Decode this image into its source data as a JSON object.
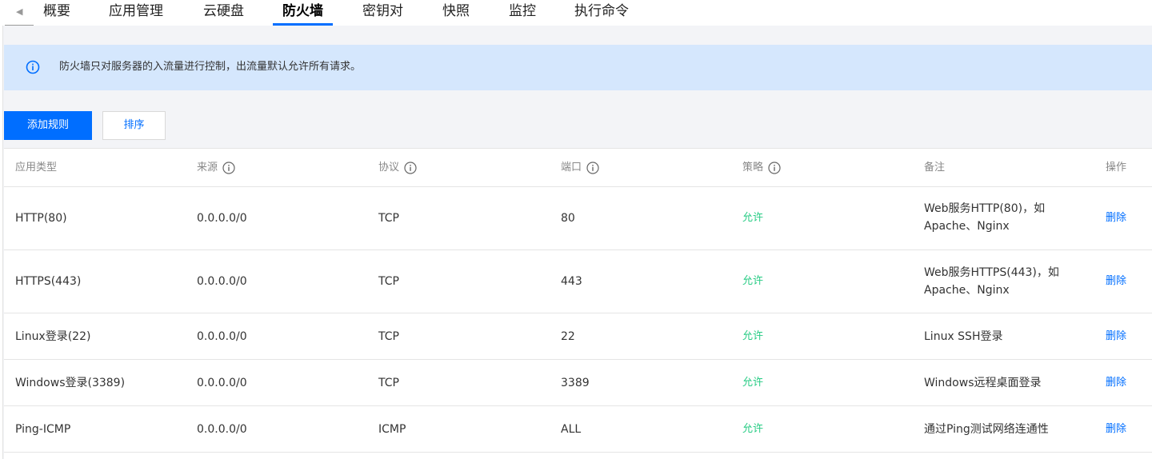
{
  "tabs": [
    {
      "label": "概要",
      "active": false
    },
    {
      "label": "应用管理",
      "active": false
    },
    {
      "label": "云硬盘",
      "active": false
    },
    {
      "label": "防火墙",
      "active": true
    },
    {
      "label": "密钥对",
      "active": false
    },
    {
      "label": "快照",
      "active": false
    },
    {
      "label": "监控",
      "active": false
    },
    {
      "label": "执行命令",
      "active": false
    }
  ],
  "notice": {
    "text": "防火墙只对服务器的入流量进行控制，出流量默认允许所有请求。"
  },
  "toolbar": {
    "add_label": "添加规则",
    "sort_label": "排序"
  },
  "table": {
    "headers": [
      "应用类型",
      "来源",
      "协议",
      "端口",
      "策略",
      "备注",
      "操作"
    ],
    "rows": [
      {
        "app": "HTTP(80)",
        "source": "0.0.0.0/0",
        "protocol": "TCP",
        "port": "80",
        "policy": "允许",
        "remark": "Web服务HTTP(80)，如Apache、Nginx",
        "action": "删除"
      },
      {
        "app": "HTTPS(443)",
        "source": "0.0.0.0/0",
        "protocol": "TCP",
        "port": "443",
        "policy": "允许",
        "remark": "Web服务HTTPS(443)，如Apache、Nginx",
        "action": "删除"
      },
      {
        "app": "Linux登录(22)",
        "source": "0.0.0.0/0",
        "protocol": "TCP",
        "port": "22",
        "policy": "允许",
        "remark": "Linux SSH登录",
        "action": "删除"
      },
      {
        "app": "Windows登录(3389)",
        "source": "0.0.0.0/0",
        "protocol": "TCP",
        "port": "3389",
        "policy": "允许",
        "remark": "Windows远程桌面登录",
        "action": "删除"
      },
      {
        "app": "Ping-ICMP",
        "source": "0.0.0.0/0",
        "protocol": "ICMP",
        "port": "ALL",
        "policy": "允许",
        "remark": "通过Ping测试网络连通性",
        "action": "删除"
      }
    ]
  },
  "colors": {
    "primary": "#006eff",
    "allow": "#29cc85",
    "notice_bg": "#d5e7fd"
  },
  "icons": {
    "tab_prev": "caret-left-icon",
    "notice": "info-circle-icon",
    "header_help": "info-circle-icon"
  }
}
